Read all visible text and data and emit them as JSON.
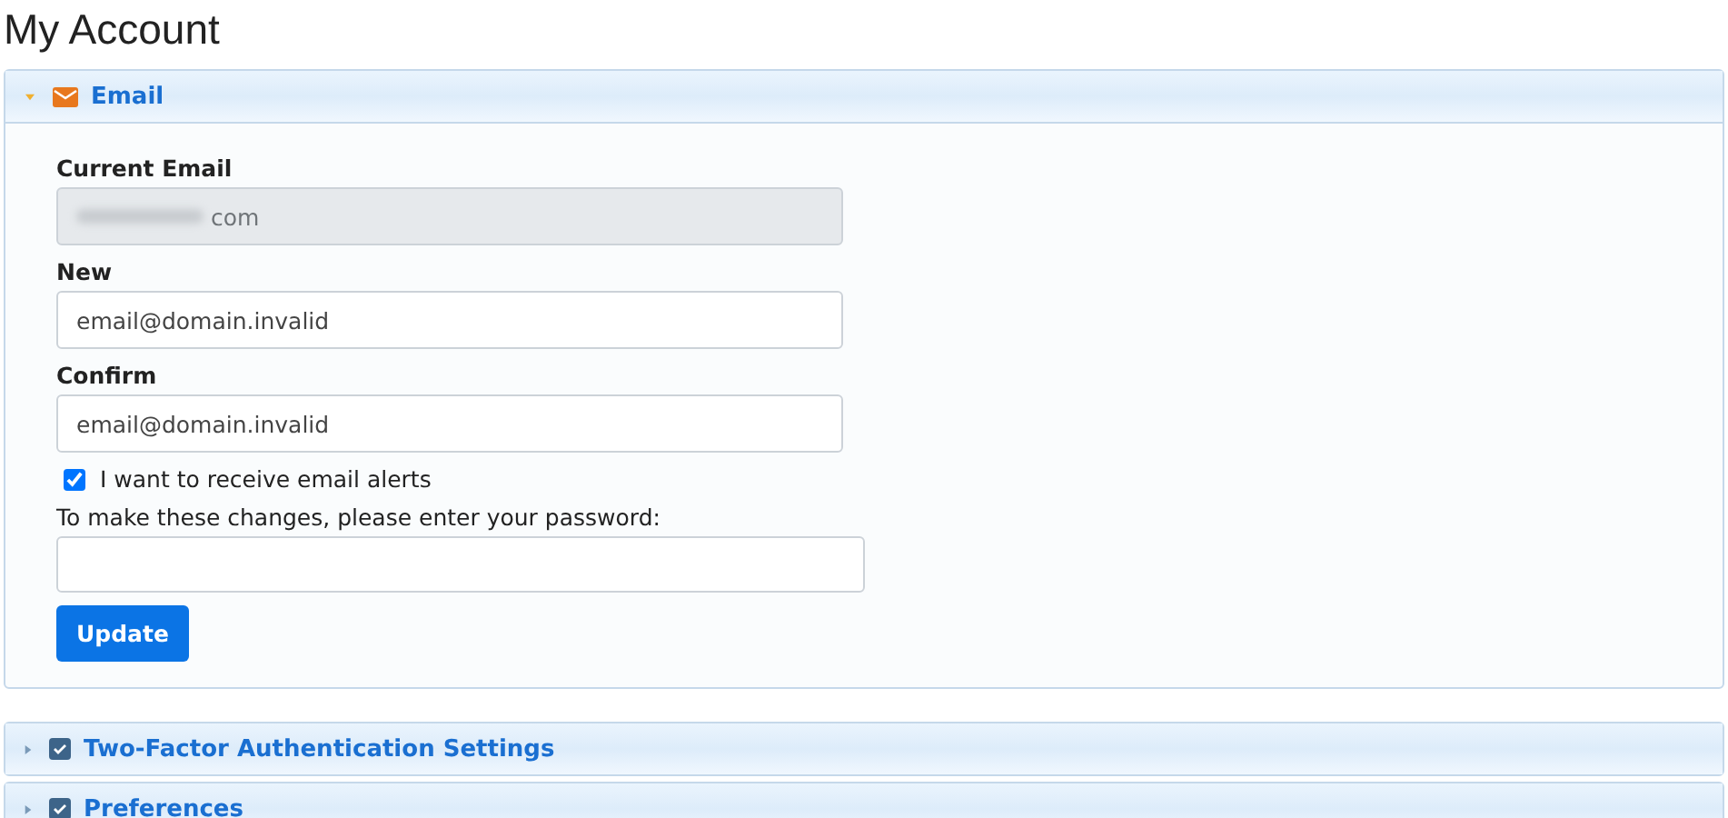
{
  "page_title": "My Account",
  "sections": [
    {
      "title": "Email",
      "expanded": true,
      "kind": "email"
    },
    {
      "title": "Two-Factor Authentication Settings",
      "expanded": false,
      "kind": "check"
    },
    {
      "title": "Preferences",
      "expanded": false,
      "kind": "check"
    }
  ],
  "email_form": {
    "current": {
      "label": "Current Email",
      "value": "com",
      "redacted": true
    },
    "new": {
      "label": "New",
      "value": "email@domain.invalid"
    },
    "confirm": {
      "label": "Confirm",
      "value": "email@domain.invalid"
    },
    "alerts": {
      "label": "I want to receive email alerts",
      "checked": true
    },
    "password": {
      "label": "To make these changes, please enter your password:"
    },
    "button": "Update"
  }
}
